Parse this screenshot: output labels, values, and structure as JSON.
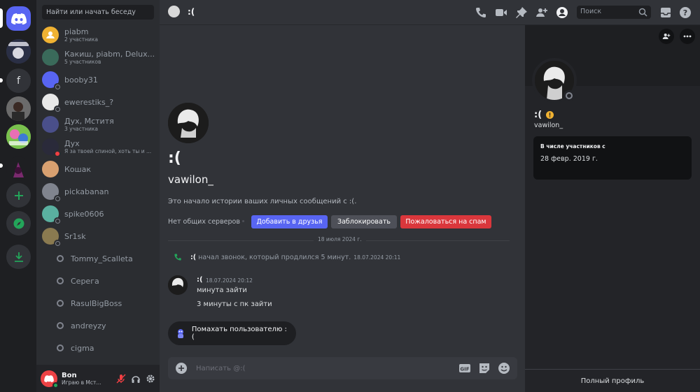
{
  "dm_list": {
    "search_placeholder": "Найти или начать беседу",
    "items": [
      {
        "name": "piabm",
        "sub": "2 участника"
      },
      {
        "name": "Какиш, piabm, Delux...",
        "sub": "5 участников"
      },
      {
        "name": "booby31",
        "sub": ""
      },
      {
        "name": "ewerestiks_?",
        "sub": ""
      },
      {
        "name": "Дух, Мститя",
        "sub": "3 участника"
      },
      {
        "name": "Дух",
        "sub": "Я за твоей спиной, хоть ты и ..."
      },
      {
        "name": "Кошак",
        "sub": ""
      },
      {
        "name": "pickabanan",
        "sub": ""
      },
      {
        "name": "spike0606",
        "sub": ""
      },
      {
        "name": "Sr1sk",
        "sub": ""
      },
      {
        "name": "Tommy_Scalleta",
        "sub": ""
      },
      {
        "name": "Серега",
        "sub": ""
      },
      {
        "name": "RasulBigBoss",
        "sub": ""
      },
      {
        "name": "andreyzy",
        "sub": ""
      },
      {
        "name": "cigma",
        "sub": ""
      }
    ]
  },
  "user_panel": {
    "name": "Bon",
    "activity": "Играю в Мст..."
  },
  "header": {
    "title": ":(",
    "search_placeholder": "Поиск"
  },
  "chat": {
    "intro_name": ":(",
    "intro_username": "vawilon_",
    "intro_text": "Это начало истории ваших личных сообщений с :(.",
    "no_common_servers": "Нет общих серверов",
    "add_friend": "Добавить в друзья",
    "block": "Заблокировать",
    "report_spam": "Пожаловаться на спам",
    "date_divider": "18 июля 2024 г.",
    "call_author": ":(",
    "call_text": "начал звонок, который продлился 5 минут.",
    "call_time": "18.07.2024 20:11",
    "message": {
      "author": ":(",
      "timestamp": "18.07.2024 20:12",
      "lines": [
        "минута зайти",
        "3 минуты с пк зайти"
      ]
    },
    "wave_button": "Помахать пользователю :(",
    "composer_placeholder": "Написать @:("
  },
  "profile": {
    "display_name": ":(",
    "username": "vawilon_",
    "member_since_label": "В числе участников с",
    "member_since_date": "28 февр. 2019 г.",
    "full_profile": "Полный профиль"
  },
  "colors": {
    "blurple": "#5865f2",
    "danger": "#da373c",
    "online": "#23a55a",
    "warning": "#f0b232"
  }
}
